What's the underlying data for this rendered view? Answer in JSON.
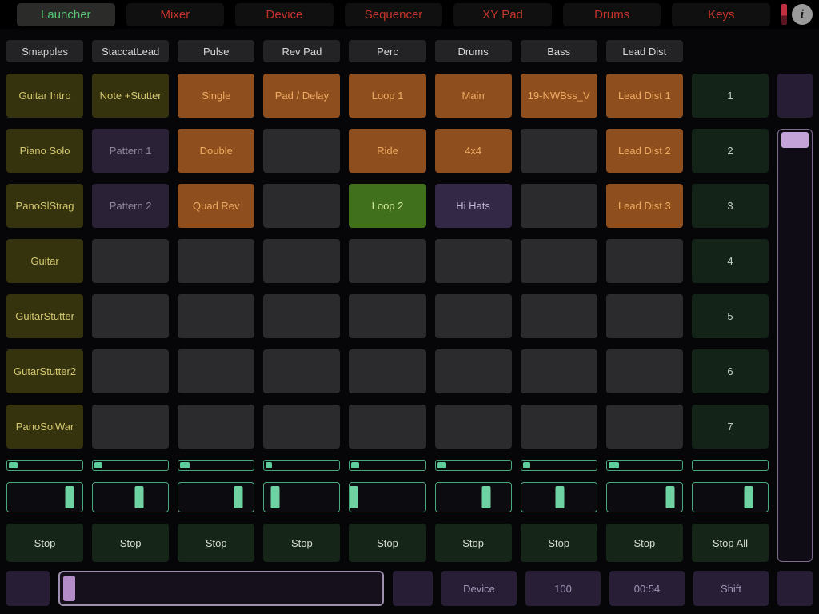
{
  "tabbar": {
    "tabs": [
      {
        "label": "Launcher",
        "active": true
      },
      {
        "label": "Mixer",
        "active": false
      },
      {
        "label": "Device",
        "active": false
      },
      {
        "label": "Sequencer",
        "active": false
      },
      {
        "label": "XY Pad",
        "active": false
      },
      {
        "label": "Drums",
        "active": false
      },
      {
        "label": "Keys",
        "active": false
      }
    ],
    "info_label": "i"
  },
  "tracks": [
    "Smapples",
    "StaccatLead",
    "Pulse",
    "Rev Pad",
    "Perc",
    "Drums",
    "Bass",
    "Lead Dist"
  ],
  "grid": {
    "rows": [
      {
        "scene": "1",
        "clips": [
          {
            "label": "Guitar Intro",
            "type": "olive"
          },
          {
            "label": "Note +Stutter",
            "type": "olive"
          },
          {
            "label": "Single",
            "type": "orange"
          },
          {
            "label": "Pad / Delay",
            "type": "orange"
          },
          {
            "label": "Loop 1",
            "type": "orange"
          },
          {
            "label": "Main",
            "type": "orange"
          },
          {
            "label": "19-NWBss_V",
            "type": "orange"
          },
          {
            "label": "Lead Dist 1",
            "type": "orange"
          }
        ]
      },
      {
        "scene": "2",
        "clips": [
          {
            "label": "Piano Solo",
            "type": "olive"
          },
          {
            "label": "Pattern 1",
            "type": "purple-dim"
          },
          {
            "label": "Double",
            "type": "orange"
          },
          {
            "label": "",
            "type": "empty"
          },
          {
            "label": "Ride",
            "type": "orange"
          },
          {
            "label": "4x4",
            "type": "orange"
          },
          {
            "label": "",
            "type": "empty"
          },
          {
            "label": "Lead Dist 2",
            "type": "orange"
          }
        ]
      },
      {
        "scene": "3",
        "clips": [
          {
            "label": "PanoSlStrag",
            "type": "olive"
          },
          {
            "label": "Pattern 2",
            "type": "purple-dim"
          },
          {
            "label": "Quad Rev",
            "type": "orange"
          },
          {
            "label": "",
            "type": "empty"
          },
          {
            "label": "Loop 2",
            "type": "green"
          },
          {
            "label": "Hi Hats",
            "type": "purple"
          },
          {
            "label": "",
            "type": "empty"
          },
          {
            "label": "Lead Dist 3",
            "type": "orange"
          }
        ]
      },
      {
        "scene": "4",
        "clips": [
          {
            "label": "Guitar",
            "type": "olive"
          },
          {
            "label": "",
            "type": "empty"
          },
          {
            "label": "",
            "type": "empty"
          },
          {
            "label": "",
            "type": "empty"
          },
          {
            "label": "",
            "type": "empty"
          },
          {
            "label": "",
            "type": "empty"
          },
          {
            "label": "",
            "type": "empty"
          },
          {
            "label": "",
            "type": "empty"
          }
        ]
      },
      {
        "scene": "5",
        "clips": [
          {
            "label": "GuitarStutter",
            "type": "olive"
          },
          {
            "label": "",
            "type": "empty"
          },
          {
            "label": "",
            "type": "empty"
          },
          {
            "label": "",
            "type": "empty"
          },
          {
            "label": "",
            "type": "empty"
          },
          {
            "label": "",
            "type": "empty"
          },
          {
            "label": "",
            "type": "empty"
          },
          {
            "label": "",
            "type": "empty"
          }
        ]
      },
      {
        "scene": "6",
        "clips": [
          {
            "label": "GutarStutter2",
            "type": "olive"
          },
          {
            "label": "",
            "type": "empty"
          },
          {
            "label": "",
            "type": "empty"
          },
          {
            "label": "",
            "type": "empty"
          },
          {
            "label": "",
            "type": "empty"
          },
          {
            "label": "",
            "type": "empty"
          },
          {
            "label": "",
            "type": "empty"
          },
          {
            "label": "",
            "type": "empty"
          }
        ]
      },
      {
        "scene": "7",
        "clips": [
          {
            "label": "PanoSolWar",
            "type": "olive"
          },
          {
            "label": "",
            "type": "empty"
          },
          {
            "label": "",
            "type": "empty"
          },
          {
            "label": "",
            "type": "empty"
          },
          {
            "label": "",
            "type": "empty"
          },
          {
            "label": "",
            "type": "empty"
          },
          {
            "label": "",
            "type": "empty"
          },
          {
            "label": "",
            "type": "empty"
          }
        ]
      }
    ]
  },
  "progress_bars": [
    12,
    10,
    12,
    8,
    10,
    12,
    10,
    14,
    0
  ],
  "sliders": [
    83,
    62,
    79,
    15,
    5,
    67,
    51,
    84,
    74
  ],
  "stop_row": {
    "stops": [
      "Stop",
      "Stop",
      "Stop",
      "Stop",
      "Stop",
      "Stop",
      "Stop",
      "Stop"
    ],
    "stop_all": "Stop All"
  },
  "bottom_bar": {
    "device": "Device",
    "tempo": "100",
    "time": "00:54",
    "shift": "Shift"
  },
  "colors": {
    "accent_teal": "#5fcd9b",
    "accent_purple": "#b48cc8",
    "tab_red": "#c5342a",
    "tab_active_green": "#56c474"
  }
}
